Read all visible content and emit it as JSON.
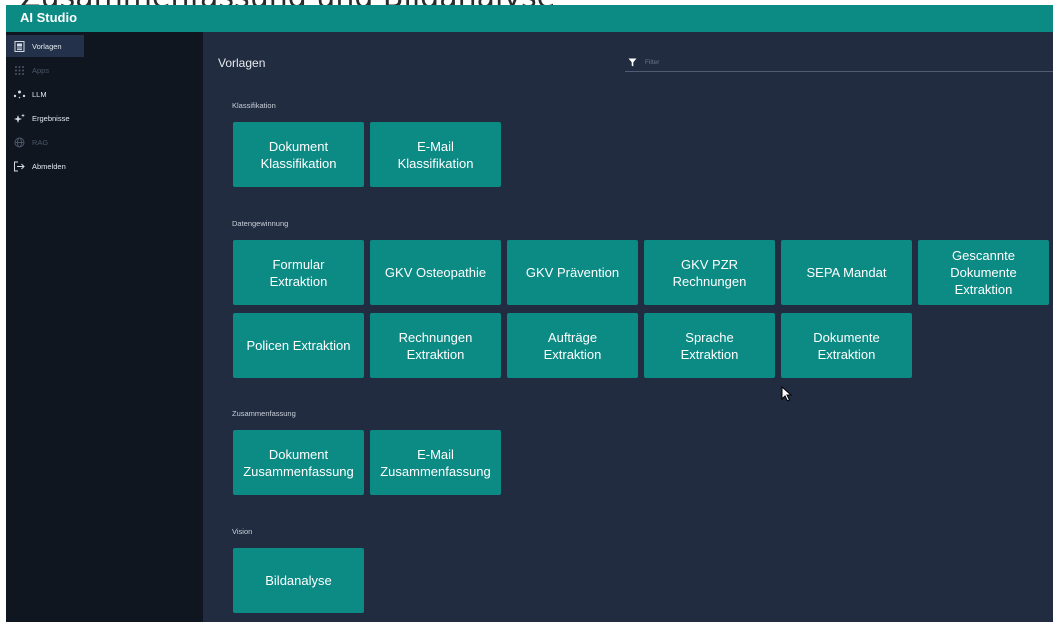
{
  "background_text": "Zusammenfassung und Bildanalyse",
  "app": {
    "title": "AI Studio"
  },
  "sidebar": {
    "items": [
      {
        "label": "Vorlagen",
        "icon": "templates-icon",
        "active": true
      },
      {
        "label": "Apps",
        "icon": "apps-grid-icon",
        "disabled": true
      },
      {
        "label": "LLM",
        "icon": "llm-nodes-icon"
      },
      {
        "label": "Ergebnisse",
        "icon": "sparkle-icon"
      },
      {
        "label": "RAG",
        "icon": "rag-globe-icon",
        "disabled": true
      },
      {
        "label": "Abmelden",
        "icon": "logout-icon"
      }
    ]
  },
  "main": {
    "title": "Vorlagen",
    "filter_placeholder": "Filter",
    "sections": [
      {
        "label": "Klassifikation",
        "tiles": [
          "Dokument\nKlassifikation",
          "E-Mail\nKlassifikation"
        ]
      },
      {
        "label": "Datengewinnung",
        "tiles": [
          "Formular\nExtraktion",
          "GKV Osteopathie",
          "GKV Prävention",
          "GKV PZR\nRechnungen",
          "SEPA Mandat",
          "Gescannte\nDokumente\nExtraktion",
          "Policen Extraktion",
          "Rechnungen\nExtraktion",
          "Aufträge\nExtraktion",
          "Sprache\nExtraktion",
          "Dokumente\nExtraktion"
        ]
      },
      {
        "label": "Zusammenfassung",
        "tiles": [
          "Dokument\nZusammenfassung",
          "E-Mail\nZusammenfassung"
        ]
      },
      {
        "label": "Vision",
        "tiles": [
          "Bildanalyse"
        ]
      }
    ]
  },
  "colors": {
    "accent": "#0c8a84",
    "background": "#222c40",
    "sidebar": "#0f1620",
    "active_nav": "#23324a"
  }
}
